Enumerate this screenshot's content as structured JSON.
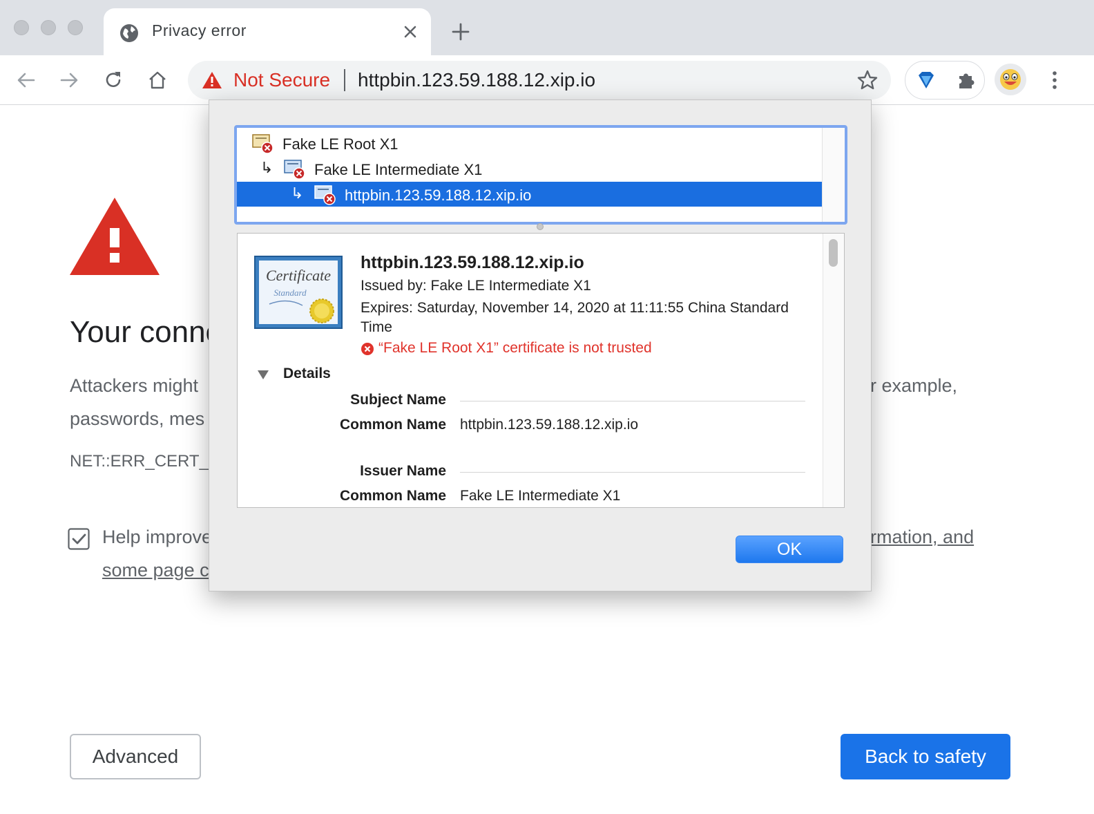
{
  "tab": {
    "title": "Privacy error"
  },
  "omnibox": {
    "security_label": "Not Secure",
    "url": "httpbin.123.59.188.12.xip.io"
  },
  "page": {
    "heading": "Your conne",
    "para_line1_left": "Attackers might",
    "para_line1_right": "r example,",
    "para_line2_left": "passwords, mes",
    "error_code": "NET::ERR_CERT_",
    "help_line1_left": "Help improve",
    "help_line1_right": "rmation, and",
    "help_line2": "some page c",
    "help_checked": true,
    "advanced_label": "Advanced",
    "back_label": "Back to safety"
  },
  "cert_dialog": {
    "chain": [
      {
        "label": "Fake LE Root X1",
        "selected": false
      },
      {
        "label": "Fake LE Intermediate X1",
        "selected": false
      },
      {
        "label": "httpbin.123.59.188.12.xip.io",
        "selected": true
      }
    ],
    "chain_arrow": "↳",
    "cert_image_title": "Certificate",
    "cert_image_subtitle": "Standard",
    "name": "httpbin.123.59.188.12.xip.io",
    "issued_by": "Issued by: Fake LE Intermediate X1",
    "expires": "Expires: Saturday, November 14, 2020 at 11:11:55 China Standard Time",
    "trust_status": "“Fake LE Root X1” certificate is not trusted",
    "details_label": "Details",
    "subject_section": "Subject Name",
    "subject_cn_key": "Common Name",
    "subject_cn_value": "httpbin.123.59.188.12.xip.io",
    "issuer_section": "Issuer Name",
    "issuer_cn_key": "Common Name",
    "issuer_cn_value": "Fake LE Intermediate X1",
    "ok_label": "OK"
  },
  "icons": {
    "tab": "globe-icon",
    "close": "close-icon",
    "new_tab": "plus-icon",
    "back": "back-arrow-icon",
    "forward": "forward-arrow-icon",
    "reload": "reload-icon",
    "home": "home-icon",
    "warning": "warning-triangle-icon",
    "bookmark": "star-icon",
    "extension1": "diamond-extension-icon",
    "extension2": "puzzle-icon",
    "profile": "emoji-avatar-icon",
    "menu": "vertical-dots-icon"
  },
  "colors": {
    "danger": "#d93025",
    "accent": "#1a73e8",
    "selection": "#1a6ee0",
    "trust_error": "#e0332b"
  }
}
